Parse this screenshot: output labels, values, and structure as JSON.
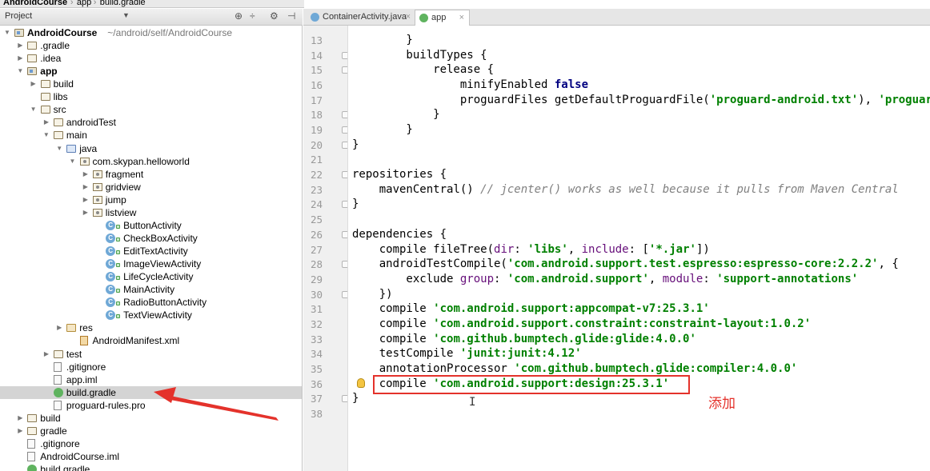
{
  "breadcrumbs": [
    "AndroidCourse",
    "app",
    "build.gradle"
  ],
  "project_panel": {
    "title": "Project",
    "dropdown_icon": "chevron-down-icon"
  },
  "tree": [
    {
      "label": "AndroidCourse",
      "path": "~/android/self/AndroidCourse",
      "depth": 0,
      "icon": "module-folder",
      "expanded": true,
      "bold": true
    },
    {
      "label": ".gradle",
      "depth": 1,
      "icon": "folder",
      "expanded": false
    },
    {
      "label": ".idea",
      "depth": 1,
      "icon": "folder",
      "expanded": false
    },
    {
      "label": "app",
      "depth": 1,
      "icon": "module-folder",
      "expanded": true,
      "bold": true
    },
    {
      "label": "build",
      "depth": 2,
      "icon": "folder",
      "expanded": false
    },
    {
      "label": "libs",
      "depth": 2,
      "icon": "folder"
    },
    {
      "label": "src",
      "depth": 2,
      "icon": "folder",
      "expanded": true
    },
    {
      "label": "androidTest",
      "depth": 3,
      "icon": "folder",
      "expanded": false
    },
    {
      "label": "main",
      "depth": 3,
      "icon": "folder",
      "expanded": true
    },
    {
      "label": "java",
      "depth": 4,
      "icon": "java-folder",
      "expanded": true
    },
    {
      "label": "com.skypan.helloworld",
      "depth": 5,
      "icon": "package",
      "expanded": true
    },
    {
      "label": "fragment",
      "depth": 6,
      "icon": "package",
      "expanded": false
    },
    {
      "label": "gridview",
      "depth": 6,
      "icon": "package",
      "expanded": false
    },
    {
      "label": "jump",
      "depth": 6,
      "icon": "package",
      "expanded": false
    },
    {
      "label": "listview",
      "depth": 6,
      "icon": "package",
      "expanded": false
    },
    {
      "label": "ButtonActivity",
      "depth": 7,
      "icon": "class"
    },
    {
      "label": "CheckBoxActivity",
      "depth": 7,
      "icon": "class"
    },
    {
      "label": "EditTextActivity",
      "depth": 7,
      "icon": "class"
    },
    {
      "label": "ImageViewActivity",
      "depth": 7,
      "icon": "class"
    },
    {
      "label": "LifeCycleActivity",
      "depth": 7,
      "icon": "class"
    },
    {
      "label": "MainActivity",
      "depth": 7,
      "icon": "class"
    },
    {
      "label": "RadioButtonActivity",
      "depth": 7,
      "icon": "class"
    },
    {
      "label": "TextViewActivity",
      "depth": 7,
      "icon": "class"
    },
    {
      "label": "res",
      "depth": 4,
      "icon": "res-folder",
      "expanded": false
    },
    {
      "label": "AndroidManifest.xml",
      "depth": 5,
      "icon": "manifest"
    },
    {
      "label": "test",
      "depth": 3,
      "icon": "folder",
      "expanded": false
    },
    {
      "label": ".gitignore",
      "depth": 3,
      "icon": "file"
    },
    {
      "label": "app.iml",
      "depth": 3,
      "icon": "file"
    },
    {
      "label": "build.gradle",
      "depth": 3,
      "icon": "gradle",
      "selected": true
    },
    {
      "label": "proguard-rules.pro",
      "depth": 3,
      "icon": "file"
    },
    {
      "label": "build",
      "depth": 1,
      "icon": "folder",
      "expanded": false
    },
    {
      "label": "gradle",
      "depth": 1,
      "icon": "folder",
      "expanded": false
    },
    {
      "label": ".gitignore",
      "depth": 1,
      "icon": "file"
    },
    {
      "label": "AndroidCourse.iml",
      "depth": 1,
      "icon": "file"
    },
    {
      "label": "build.gradle",
      "depth": 1,
      "icon": "gradle"
    }
  ],
  "tabs": [
    {
      "label": "ContainerActivity.java",
      "icon": "class-icon",
      "active": false
    },
    {
      "label": "app",
      "icon": "gradle-icon",
      "active": true
    }
  ],
  "code_lines": [
    {
      "n": "13",
      "tokens": [
        [
          "",
          "        }"
        ]
      ]
    },
    {
      "n": "14",
      "tokens": [
        [
          "",
          "        buildTypes {"
        ]
      ]
    },
    {
      "n": "15",
      "tokens": [
        [
          "",
          "            release {"
        ]
      ]
    },
    {
      "n": "16",
      "tokens": [
        [
          "",
          "                minifyEnabled "
        ],
        [
          "kw",
          "false"
        ]
      ]
    },
    {
      "n": "17",
      "tokens": [
        [
          "",
          "                proguardFiles getDefaultProguardFile("
        ],
        [
          "str",
          "'proguard-android.txt'"
        ],
        [
          "",
          "), "
        ],
        [
          "str",
          "'proguard-r"
        ]
      ]
    },
    {
      "n": "18",
      "tokens": [
        [
          "",
          "            }"
        ]
      ]
    },
    {
      "n": "19",
      "tokens": [
        [
          "",
          "        }"
        ]
      ]
    },
    {
      "n": "20",
      "tokens": [
        [
          "",
          "}"
        ]
      ]
    },
    {
      "n": "21",
      "tokens": [
        [
          "",
          ""
        ]
      ]
    },
    {
      "n": "22",
      "tokens": [
        [
          "",
          "repositories {"
        ]
      ]
    },
    {
      "n": "23",
      "tokens": [
        [
          "",
          "    mavenCentral() "
        ],
        [
          "cm",
          "// jcenter() works as well because it pulls from Maven Central"
        ]
      ]
    },
    {
      "n": "24",
      "tokens": [
        [
          "",
          "}"
        ]
      ]
    },
    {
      "n": "25",
      "tokens": [
        [
          "",
          ""
        ]
      ]
    },
    {
      "n": "26",
      "tokens": [
        [
          "",
          "dependencies {"
        ]
      ]
    },
    {
      "n": "27",
      "tokens": [
        [
          "",
          "    compile fileTree("
        ],
        [
          "named",
          "dir"
        ],
        [
          "",
          ": "
        ],
        [
          "str",
          "'libs'"
        ],
        [
          "",
          ", "
        ],
        [
          "named",
          "include"
        ],
        [
          "",
          ": ["
        ],
        [
          "str",
          "'*.jar'"
        ],
        [
          "",
          "])"
        ]
      ]
    },
    {
      "n": "28",
      "tokens": [
        [
          "",
          "    androidTestCompile("
        ],
        [
          "str",
          "'com.android.support.test.espresso:espresso-core:2.2.2'"
        ],
        [
          "",
          ", {"
        ]
      ]
    },
    {
      "n": "29",
      "tokens": [
        [
          "",
          "        exclude "
        ],
        [
          "named",
          "group"
        ],
        [
          "",
          ": "
        ],
        [
          "str",
          "'com.android.support'"
        ],
        [
          "",
          ", "
        ],
        [
          "named",
          "module"
        ],
        [
          "",
          ": "
        ],
        [
          "str",
          "'support-annotations'"
        ]
      ]
    },
    {
      "n": "30",
      "tokens": [
        [
          "",
          "    })"
        ]
      ]
    },
    {
      "n": "31",
      "tokens": [
        [
          "",
          "    compile "
        ],
        [
          "str",
          "'com.android.support:appcompat-v7:25.3.1'"
        ]
      ]
    },
    {
      "n": "32",
      "tokens": [
        [
          "",
          "    compile "
        ],
        [
          "str",
          "'com.android.support.constraint:constraint-layout:1.0.2'"
        ]
      ]
    },
    {
      "n": "33",
      "tokens": [
        [
          "",
          "    compile "
        ],
        [
          "str",
          "'com.github.bumptech.glide:glide:4.0.0'"
        ]
      ]
    },
    {
      "n": "34",
      "tokens": [
        [
          "",
          "    testCompile "
        ],
        [
          "str",
          "'junit:junit:4.12'"
        ]
      ]
    },
    {
      "n": "35",
      "tokens": [
        [
          "",
          "    annotationProcessor "
        ],
        [
          "str",
          "'com.github.bumptech.glide:compiler:4.0.0'"
        ]
      ]
    },
    {
      "n": "36",
      "tokens": [
        [
          "",
          "    compile "
        ],
        [
          "str",
          "'com.android.support:design:25.3.1'"
        ]
      ]
    },
    {
      "n": "37",
      "tokens": [
        [
          "",
          "}"
        ]
      ]
    },
    {
      "n": "38",
      "tokens": [
        [
          "",
          ""
        ]
      ]
    }
  ],
  "annotation": {
    "note_text": "添加",
    "highlight_color": "#e4322b"
  },
  "colors": {
    "selection": "#d4d4d4",
    "string": "#008000",
    "keyword": "#000080",
    "comment": "#808080"
  }
}
